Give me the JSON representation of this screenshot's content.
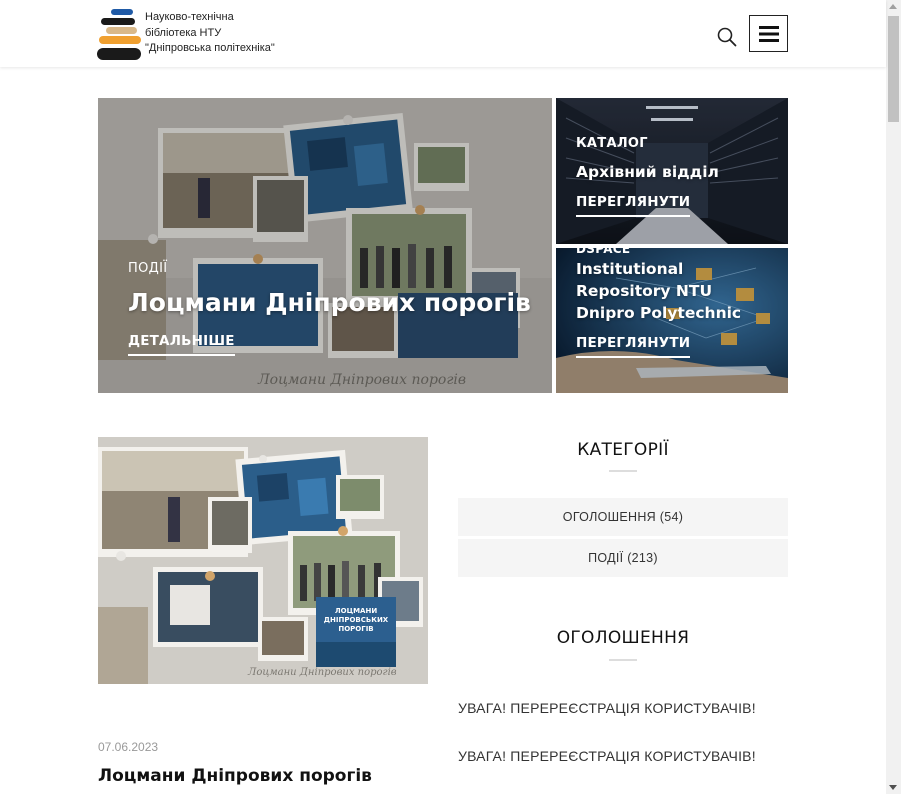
{
  "header": {
    "logo_line1": "Науково-технічна",
    "logo_line2": "бібліотека НТУ",
    "logo_line3": "\"Дніпровська політехніка\"",
    "search_icon": "search-icon",
    "menu_icon": "hamburger-menu-icon"
  },
  "hero": {
    "main": {
      "category": "ПОДІЇ",
      "title": "Лоцмани Дніпрових порогів",
      "link": "ДЕТАЛЬНІШЕ",
      "collage_caption": "Лоцмани Дніпрових порогів"
    },
    "side1": {
      "category": "КАТАЛОГ",
      "title": "Архівний відділ",
      "link": "ПЕРЕГЛЯНУТИ"
    },
    "side2": {
      "category": "DSPACE",
      "title_line1": "Institutional",
      "title_line2": "Repository NTU",
      "title_line3": "Dnipro Polytechnic",
      "link": "ПЕРЕГЛЯНУТИ"
    }
  },
  "post": {
    "date": "07.06.2023",
    "title": "Лоцмани Дніпрових порогів",
    "poster_line1": "ЛОЦМАНИ",
    "poster_line2": "ДНІПРОВСЬКИХ",
    "poster_line3": "ПОРОГІВ",
    "collage_caption": "Лоцмани Дніпрових порогів"
  },
  "sidebar": {
    "categories_title": "КАТЕГОРІЇ",
    "categories": [
      {
        "label": "ОГОЛОШЕННЯ (54)"
      },
      {
        "label": "ПОДІЇ (213)"
      }
    ],
    "announcements_title": "ОГОЛОШЕННЯ",
    "announcements": [
      {
        "label": "УВАГА! ПЕРЕРЕЄСТРАЦІЯ КОРИСТУВАЧІВ!"
      },
      {
        "label": "УВАГА! ПЕРЕРЕЄСТРАЦІЯ КОРИСТУВАЧІВ!"
      }
    ]
  },
  "colors": {
    "accent_dark": "#111111",
    "logo_blue": "#1f5aa6",
    "logo_orange": "#f0a030",
    "logo_tan": "#d9b98a",
    "logo_black": "#1a1a1a"
  }
}
